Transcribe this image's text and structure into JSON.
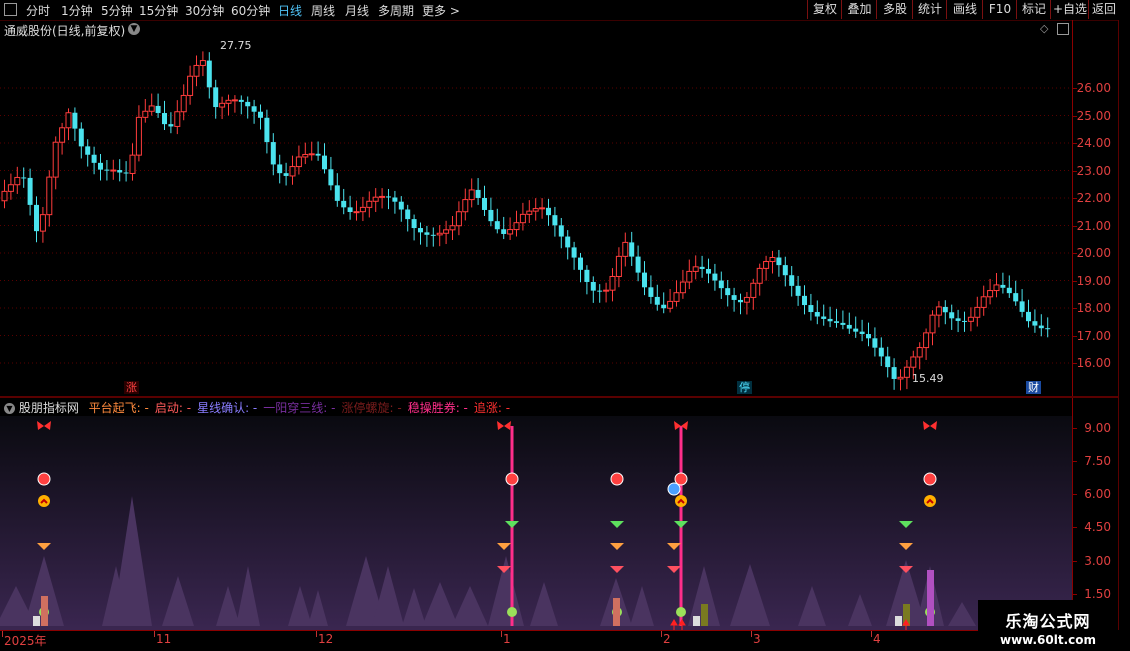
{
  "toolbar": {
    "periods": [
      {
        "label": "分时",
        "active": false
      },
      {
        "label": "1分钟",
        "active": false
      },
      {
        "label": "5分钟",
        "active": false
      },
      {
        "label": "15分钟",
        "active": false
      },
      {
        "label": "30分钟",
        "active": false
      },
      {
        "label": "60分钟",
        "active": false
      },
      {
        "label": "日线",
        "active": true
      },
      {
        "label": "周线",
        "active": false
      },
      {
        "label": "月线",
        "active": false
      },
      {
        "label": "多周期",
        "active": false
      },
      {
        "label": "更多 >",
        "active": false
      }
    ],
    "right_buttons": [
      "复权",
      "叠加",
      "多股",
      "统计",
      "画线",
      "F10",
      "标记",
      "+自选",
      "返回"
    ]
  },
  "stock": {
    "title": "通威股份(日线,前复权)",
    "high_label": "27.75",
    "low_label": "15.49"
  },
  "price_axis": [
    "26.00",
    "25.00",
    "24.00",
    "23.00",
    "22.00",
    "21.00",
    "20.00",
    "19.00",
    "18.00",
    "17.00",
    "16.00"
  ],
  "indicator": {
    "name": "股朋指标网",
    "parts": [
      {
        "text": "平台起飞: -",
        "color": "#ff8a3d"
      },
      {
        "text": "启动: -",
        "color": "#ff5a5a"
      },
      {
        "text": "星线确认: -",
        "color": "#8a7dff"
      },
      {
        "text": "一阳穿三线: -",
        "color": "#7a2fa0"
      },
      {
        "text": "涨停螺旋: -",
        "color": "#7a1c1c"
      },
      {
        "text": "稳操胜券: -",
        "color": "#ff2e8a"
      },
      {
        "text": "追涨: -",
        "color": "#ff3030"
      }
    ],
    "axis": [
      "9.00",
      "7.50",
      "6.00",
      "4.50",
      "3.00",
      "1.50"
    ]
  },
  "event_tags": [
    {
      "text": "涨",
      "color": "#ff4040",
      "bg": "#2a0000"
    },
    {
      "text": "停",
      "color": "#4fe0ff",
      "bg": "#003040"
    },
    {
      "text": "财",
      "color": "#fff",
      "bg": "#1a4aa0"
    }
  ],
  "time_axis": [
    "2025年",
    "11",
    "12",
    "1",
    "2",
    "3",
    "4"
  ],
  "watermark": {
    "line1": "乐淘公式网",
    "line2": "www.60lt.com"
  },
  "colors": {
    "up": "#ff3c3c",
    "down": "#4be3ee",
    "grid": "#5a0000",
    "axis_text": "#e04040"
  }
}
